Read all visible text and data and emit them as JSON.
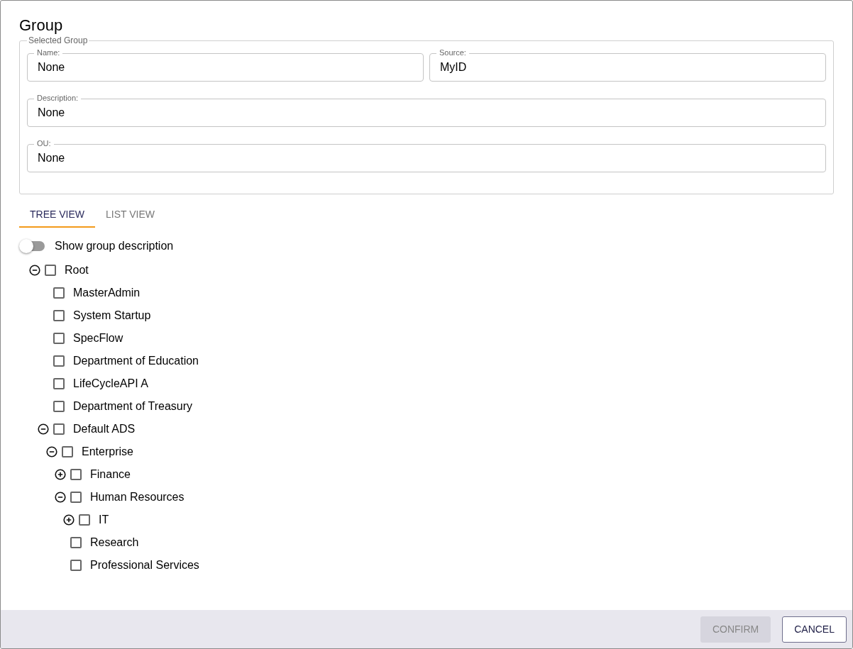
{
  "dialog": {
    "title": "Group"
  },
  "selected_group": {
    "legend": "Selected Group",
    "rows": [
      [
        {
          "label": "Name:",
          "value": "None"
        },
        {
          "label": "Source:",
          "value": "MyID"
        }
      ],
      [
        {
          "label": "Description:",
          "value": "None"
        }
      ],
      [
        {
          "label": "OU:",
          "value": "None"
        }
      ]
    ]
  },
  "tabs": [
    {
      "label": "TREE VIEW",
      "selected": true
    },
    {
      "label": "LIST VIEW",
      "selected": false
    }
  ],
  "toggle": {
    "label": "Show group description",
    "on": false
  },
  "tree": [
    {
      "label": "Root",
      "checked": false,
      "expanded": true,
      "children": [
        {
          "label": "MasterAdmin",
          "checked": false
        },
        {
          "label": "System Startup",
          "checked": false
        },
        {
          "label": "SpecFlow",
          "checked": false
        },
        {
          "label": "Department of Education",
          "checked": false
        },
        {
          "label": "LifeCycleAPI A",
          "checked": false
        },
        {
          "label": "Department of Treasury",
          "checked": false
        },
        {
          "label": "Default ADS",
          "checked": false,
          "expanded": true,
          "children": [
            {
              "label": "Enterprise",
              "checked": false,
              "expanded": true,
              "children": [
                {
                  "label": "Finance",
                  "checked": false,
                  "expanded": false
                },
                {
                  "label": "Human Resources",
                  "checked": false,
                  "expanded": true,
                  "children": [
                    {
                      "label": "IT",
                      "checked": false,
                      "expanded": false
                    }
                  ]
                },
                {
                  "label": "Research",
                  "checked": false
                },
                {
                  "label": "Professional Services",
                  "checked": false
                }
              ]
            }
          ]
        }
      ]
    }
  ],
  "buttons": [
    {
      "label": "CONFIRM",
      "disabled": true
    },
    {
      "label": "CANCEL",
      "disabled": false
    }
  ]
}
